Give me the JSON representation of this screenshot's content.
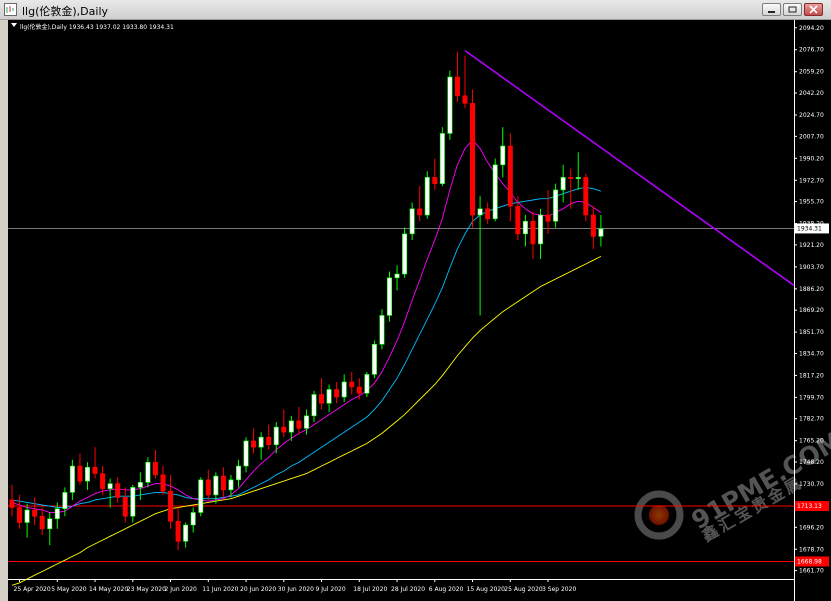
{
  "window": {
    "title": "llg(伦敦金),Daily"
  },
  "chart_info": "llg(伦敦金),Daily  1936.43 1937.02 1933.80 1934.31",
  "watermark": {
    "site": "91PME.COM",
    "brand": "鑫汇宝贵金属"
  },
  "colors": {
    "background": "#000000",
    "bull_candle": "#ffffff",
    "bull_candle_border": "#00ff00",
    "bear_candle": "#ff0000",
    "ma_fast": "#ff00ff",
    "ma_mid": "#00bfff",
    "ma_slow": "#ffff00",
    "trendline": "#b000ff",
    "level_line": "#ff0000",
    "crosshair": "#c0c0c0"
  },
  "chart_data": {
    "type": "candlestick",
    "symbol": "llg(伦敦金)",
    "timeframe": "Daily",
    "last_ohlc": {
      "open": 1936.43,
      "high": 1937.02,
      "low": 1933.8,
      "close": 1934.31
    },
    "ylim": [
      1655,
      2098
    ],
    "y_ticks": [
      "2094.20",
      "2076.70",
      "2059.20",
      "2042.20",
      "2024.70",
      "2007.70",
      "1990.20",
      "1972.70",
      "1955.70",
      "1938.20",
      "1921.20",
      "1903.70",
      "1886.20",
      "1869.20",
      "1851.70",
      "1834.70",
      "1817.20",
      "1799.70",
      "1782.70",
      "1765.20",
      "1748.20",
      "1730.70",
      "1713.20",
      "1696.20",
      "1678.70",
      "1661.70"
    ],
    "x_ticks": [
      "25 Apr 2020",
      "5 May 2020",
      "14 May 2020",
      "23 May 2020",
      "2 Jun 2020",
      "11 Jun 2020",
      "20 Jun 2020",
      "30 Jun 2020",
      "9 Jul 2020",
      "18 Jul 2020",
      "28 Jul 2020",
      "6 Aug 2020",
      "15 Aug 2020",
      "25 Aug 2020",
      "3 Sep 2020"
    ],
    "current_price": "1934.31",
    "levels": [
      {
        "value": "1713.13",
        "label": "1713.13"
      },
      {
        "value": "1668.98",
        "label": "1668.98"
      }
    ],
    "candles": [
      [
        1718,
        1730,
        1705,
        1712
      ],
      [
        1712,
        1722,
        1695,
        1700
      ],
      [
        1700,
        1715,
        1688,
        1710
      ],
      [
        1710,
        1720,
        1698,
        1705
      ],
      [
        1705,
        1712,
        1690,
        1695
      ],
      [
        1695,
        1708,
        1682,
        1703
      ],
      [
        1703,
        1716,
        1695,
        1711
      ],
      [
        1711,
        1728,
        1705,
        1724
      ],
      [
        1724,
        1750,
        1718,
        1745
      ],
      [
        1745,
        1755,
        1730,
        1733
      ],
      [
        1733,
        1748,
        1726,
        1744
      ],
      [
        1744,
        1760,
        1735,
        1739
      ],
      [
        1739,
        1745,
        1722,
        1727
      ],
      [
        1727,
        1735,
        1712,
        1731
      ],
      [
        1731,
        1736,
        1716,
        1720
      ],
      [
        1720,
        1728,
        1700,
        1705
      ],
      [
        1705,
        1730,
        1700,
        1728
      ],
      [
        1728,
        1740,
        1718,
        1732
      ],
      [
        1732,
        1752,
        1728,
        1748
      ],
      [
        1748,
        1758,
        1735,
        1738
      ],
      [
        1738,
        1745,
        1722,
        1725
      ],
      [
        1725,
        1738,
        1695,
        1701
      ],
      [
        1701,
        1712,
        1678,
        1685
      ],
      [
        1685,
        1700,
        1680,
        1698
      ],
      [
        1698,
        1712,
        1692,
        1708
      ],
      [
        1708,
        1736,
        1705,
        1734
      ],
      [
        1734,
        1742,
        1718,
        1722
      ],
      [
        1722,
        1740,
        1715,
        1737
      ],
      [
        1737,
        1744,
        1720,
        1726
      ],
      [
        1726,
        1738,
        1720,
        1734
      ],
      [
        1734,
        1750,
        1728,
        1745
      ],
      [
        1745,
        1768,
        1740,
        1765
      ],
      [
        1765,
        1775,
        1755,
        1760
      ],
      [
        1760,
        1772,
        1750,
        1768
      ],
      [
        1768,
        1778,
        1758,
        1762
      ],
      [
        1762,
        1780,
        1755,
        1776
      ],
      [
        1776,
        1790,
        1768,
        1772
      ],
      [
        1772,
        1785,
        1765,
        1781
      ],
      [
        1781,
        1792,
        1770,
        1775
      ],
      [
        1775,
        1790,
        1770,
        1785
      ],
      [
        1785,
        1805,
        1780,
        1802
      ],
      [
        1802,
        1815,
        1790,
        1795
      ],
      [
        1795,
        1810,
        1788,
        1806
      ],
      [
        1806,
        1812,
        1795,
        1800
      ],
      [
        1800,
        1818,
        1796,
        1812
      ],
      [
        1812,
        1820,
        1802,
        1808
      ],
      [
        1808,
        1815,
        1798,
        1803
      ],
      [
        1803,
        1820,
        1800,
        1818
      ],
      [
        1818,
        1845,
        1815,
        1842
      ],
      [
        1842,
        1870,
        1838,
        1865
      ],
      [
        1865,
        1900,
        1860,
        1895
      ],
      [
        1895,
        1905,
        1885,
        1898
      ],
      [
        1898,
        1935,
        1895,
        1930
      ],
      [
        1930,
        1955,
        1925,
        1950
      ],
      [
        1950,
        1968,
        1940,
        1945
      ],
      [
        1945,
        1980,
        1942,
        1975
      ],
      [
        1975,
        1990,
        1965,
        1970
      ],
      [
        1970,
        2015,
        1968,
        2010
      ],
      [
        2010,
        2060,
        2005,
        2055
      ],
      [
        2055,
        2075,
        2035,
        2040
      ],
      [
        2040,
        2072,
        2030,
        2034
      ],
      [
        2034,
        2045,
        1935,
        1945
      ],
      [
        1945,
        1960,
        1865,
        1950
      ],
      [
        1950,
        1955,
        1938,
        1942
      ],
      [
        1942,
        1990,
        1940,
        1985
      ],
      [
        1985,
        2015,
        1975,
        2000
      ],
      [
        2000,
        2010,
        1940,
        1952
      ],
      [
        1952,
        1960,
        1925,
        1930
      ],
      [
        1930,
        1945,
        1920,
        1940
      ],
      [
        1940,
        1948,
        1910,
        1922
      ],
      [
        1922,
        1950,
        1910,
        1945
      ],
      [
        1945,
        1965,
        1930,
        1940
      ],
      [
        1940,
        1970,
        1935,
        1965
      ],
      [
        1965,
        1985,
        1955,
        1975
      ],
      [
        1975,
        1982,
        1950,
        1974
      ],
      [
        1974,
        1995,
        1965,
        1975
      ],
      [
        1975,
        1978,
        1940,
        1945
      ],
      [
        1945,
        1952,
        1918,
        1928
      ],
      [
        1928,
        1945,
        1920,
        1934
      ]
    ],
    "ma_fast": [
      1716,
      1714,
      1712,
      1711,
      1710,
      1708,
      1708,
      1709,
      1713,
      1717,
      1720,
      1723,
      1725,
      1726,
      1727,
      1726,
      1726,
      1727,
      1729,
      1731,
      1731,
      1729,
      1726,
      1722,
      1719,
      1718,
      1717,
      1718,
      1719,
      1722,
      1727,
      1734,
      1741,
      1747,
      1752,
      1758,
      1763,
      1767,
      1771,
      1774,
      1778,
      1782,
      1786,
      1790,
      1794,
      1798,
      1801,
      1805,
      1811,
      1820,
      1832,
      1845,
      1860,
      1877,
      1893,
      1910,
      1925,
      1942,
      1965,
      1985,
      1998,
      2005,
      1998,
      1987,
      1978,
      1970,
      1963,
      1955,
      1950,
      1946,
      1945,
      1944,
      1947,
      1950,
      1954,
      1956,
      1955,
      1951,
      1947
    ],
    "ma_mid": [
      1718,
      1717,
      1716,
      1715,
      1714,
      1713,
      1712,
      1712,
      1713,
      1715,
      1716,
      1718,
      1719,
      1720,
      1721,
      1721,
      1721,
      1722,
      1723,
      1724,
      1724,
      1723,
      1722,
      1720,
      1719,
      1719,
      1719,
      1719,
      1720,
      1721,
      1722,
      1725,
      1728,
      1731,
      1734,
      1738,
      1741,
      1745,
      1748,
      1752,
      1756,
      1760,
      1764,
      1768,
      1772,
      1776,
      1780,
      1784,
      1790,
      1797,
      1806,
      1815,
      1826,
      1838,
      1850,
      1862,
      1874,
      1887,
      1903,
      1918,
      1930,
      1940,
      1945,
      1948,
      1950,
      1952,
      1954,
      1955,
      1956,
      1957,
      1958,
      1958,
      1960,
      1962,
      1964,
      1966,
      1967,
      1966,
      1964
    ],
    "ma_slow": [
      1650,
      1652,
      1655,
      1658,
      1661,
      1664,
      1667,
      1670,
      1673,
      1676,
      1680,
      1683,
      1686,
      1689,
      1692,
      1695,
      1698,
      1701,
      1704,
      1707,
      1709,
      1711,
      1712,
      1713,
      1714,
      1715,
      1716,
      1717,
      1718,
      1719,
      1721,
      1723,
      1725,
      1727,
      1729,
      1731,
      1733,
      1735,
      1737,
      1739,
      1742,
      1745,
      1748,
      1751,
      1754,
      1757,
      1760,
      1763,
      1767,
      1771,
      1776,
      1781,
      1786,
      1792,
      1798,
      1804,
      1810,
      1817,
      1825,
      1833,
      1840,
      1847,
      1853,
      1858,
      1863,
      1868,
      1872,
      1876,
      1880,
      1884,
      1888,
      1891,
      1894,
      1897,
      1900,
      1903,
      1906,
      1909,
      1912
    ],
    "trendline": {
      "from": [
        60,
        2076
      ],
      "to": [
        111,
        1857
      ]
    }
  }
}
